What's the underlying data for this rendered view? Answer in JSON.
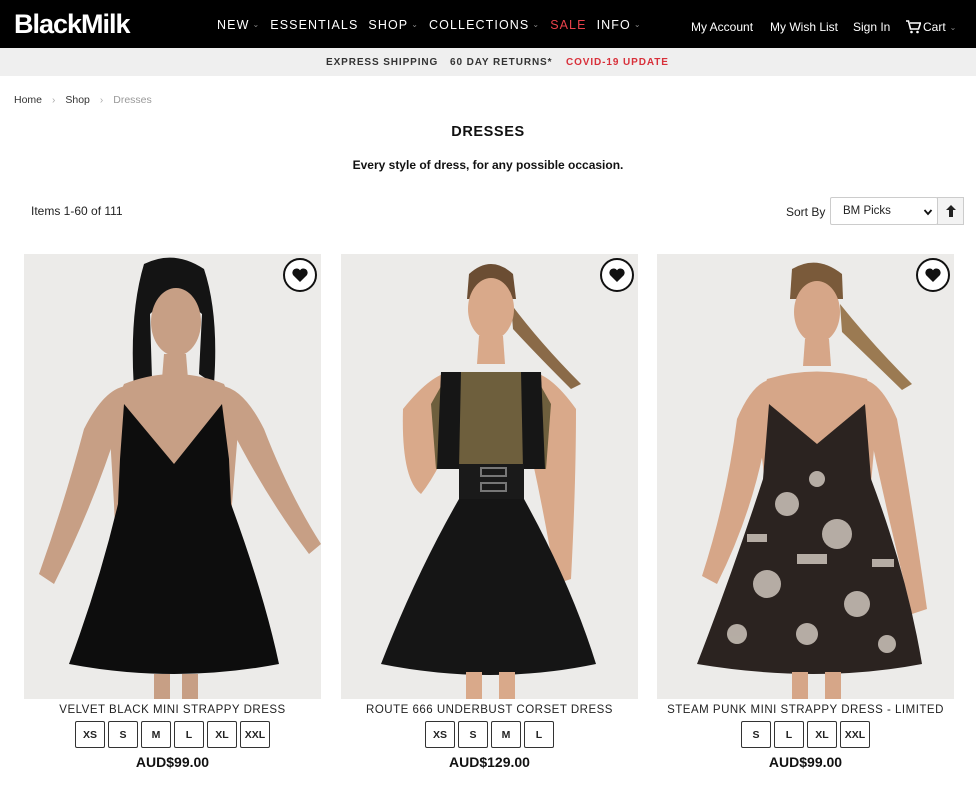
{
  "header": {
    "logo": "BlackMilk",
    "nav": [
      {
        "label": "NEW",
        "chevron": true
      },
      {
        "label": "ESSENTIALS",
        "chevron": false
      },
      {
        "label": "SHOP",
        "chevron": true
      },
      {
        "label": "COLLECTIONS",
        "chevron": true
      },
      {
        "label": "SALE",
        "chevron": false
      },
      {
        "label": "INFO",
        "chevron": true
      }
    ],
    "my_account": "My Account",
    "wish_list": "My Wish List",
    "sign_in": "Sign In",
    "cart": "Cart",
    "sale_color": "#e8414a"
  },
  "promo": {
    "shipping": "EXPRESS SHIPPING",
    "returns": "60 DAY RETURNS*",
    "covid": "COVID-19 UPDATE"
  },
  "breadcrumb": [
    "Home",
    "Shop",
    "Dresses"
  ],
  "page": {
    "title": "DRESSES",
    "subtitle": "Every style of dress, for any possible occasion.",
    "items_count": "Items 1-60 of 111",
    "sort_label": "Sort By",
    "sort_value": "BM Picks"
  },
  "products": [
    {
      "name": "VELVET BLACK MINI STRAPPY DRESS",
      "sizes": [
        "XS",
        "S",
        "M",
        "L",
        "XL",
        "XXL"
      ],
      "price": "AUD$99.00",
      "photo": "black-velvet-dress"
    },
    {
      "name": "ROUTE 666 UNDERBUST CORSET DRESS",
      "sizes": [
        "XS",
        "S",
        "M",
        "L"
      ],
      "price": "AUD$129.00",
      "photo": "leopard-corset-dress"
    },
    {
      "name": "STEAM PUNK MINI STRAPPY DRESS - LIMITED",
      "sizes": [
        "S",
        "L",
        "XL",
        "XXL"
      ],
      "price": "AUD$99.00",
      "photo": "steampunk-print-dress"
    }
  ]
}
